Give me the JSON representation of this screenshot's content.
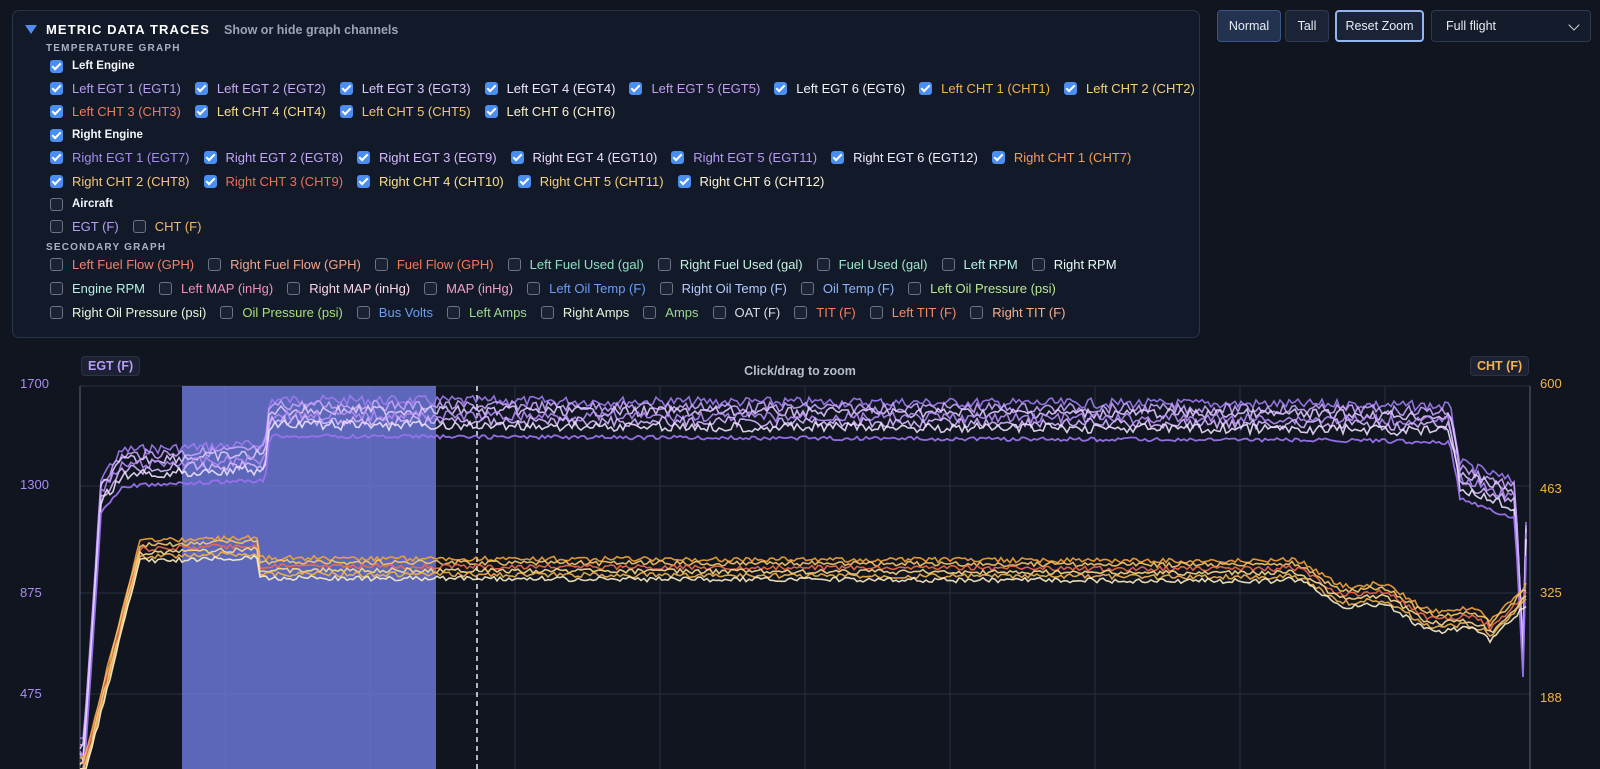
{
  "panel": {
    "title": "METRIC DATA TRACES",
    "subtitle": "Show or hide graph channels",
    "temperature_label": "TEMPERATURE GRAPH",
    "secondary_label": "SECONDARY GRAPH",
    "left_engine": "Left Engine",
    "right_engine": "Right Engine",
    "aircraft": "Aircraft",
    "left_row1": [
      {
        "label": "Left EGT 1 (EGT1)",
        "color": "#b89cf0",
        "checked": true
      },
      {
        "label": "Left EGT 2 (EGT2)",
        "color": "#c8a8f5",
        "checked": true
      },
      {
        "label": "Left EGT 3 (EGT3)",
        "color": "#dcc6ff",
        "checked": true
      },
      {
        "label": "Left EGT 4 (EGT4)",
        "color": "#f0e6ff",
        "checked": true
      },
      {
        "label": "Left EGT 5 (EGT5)",
        "color": "#c49cf2",
        "checked": true
      },
      {
        "label": "Left EGT 6 (EGT6)",
        "color": "#f4f0ff",
        "checked": true
      },
      {
        "label": "Left CHT 1 (CHT1)",
        "color": "#f5b34a",
        "checked": true
      },
      {
        "label": "Left CHT 2 (CHT2)",
        "color": "#f5d27a",
        "checked": true
      }
    ],
    "left_row2": [
      {
        "label": "Left CHT 3 (CHT3)",
        "color": "#f07a5e",
        "checked": true
      },
      {
        "label": "Left CHT 4 (CHT4)",
        "color": "#f7dc88",
        "checked": true
      },
      {
        "label": "Left CHT 5 (CHT5)",
        "color": "#f5c56a",
        "checked": true
      },
      {
        "label": "Left CHT 6 (CHT6)",
        "color": "#fbf1cf",
        "checked": true
      }
    ],
    "right_row1": [
      {
        "label": "Right EGT 1 (EGT7)",
        "color": "#a78bef",
        "checked": true
      },
      {
        "label": "Right EGT 2 (EGT8)",
        "color": "#c4a4f5",
        "checked": true
      },
      {
        "label": "Right EGT 3 (EGT9)",
        "color": "#d6b8ff",
        "checked": true
      },
      {
        "label": "Right EGT 4 (EGT10)",
        "color": "#efdcff",
        "checked": true
      },
      {
        "label": "Right EGT 5 (EGT11)",
        "color": "#b99af2",
        "checked": true
      },
      {
        "label": "Right EGT 6 (EGT12)",
        "color": "#f2ecff",
        "checked": true
      },
      {
        "label": "Right CHT 1 (CHT7)",
        "color": "#f59e4a",
        "checked": true
      }
    ],
    "right_row2": [
      {
        "label": "Right CHT 2 (CHT8)",
        "color": "#f5c677",
        "checked": true
      },
      {
        "label": "Right CHT 3 (CHT9)",
        "color": "#ef6f5a",
        "checked": true
      },
      {
        "label": "Right CHT 4 (CHT10)",
        "color": "#f8e08c",
        "checked": true
      },
      {
        "label": "Right CHT 5 (CHT11)",
        "color": "#f5d07c",
        "checked": true
      },
      {
        "label": "Right CHT 6 (CHT12)",
        "color": "#fcf3d6",
        "checked": true
      }
    ],
    "aircraft_row": [
      {
        "label": "EGT (F)",
        "color": "#b79cf5",
        "checked": false
      },
      {
        "label": "CHT (F)",
        "color": "#f5b86a",
        "checked": false
      }
    ],
    "sec_row1": [
      {
        "label": "Left Fuel Flow (GPH)",
        "color": "#f5826a",
        "checked": false
      },
      {
        "label": "Right Fuel Flow (GPH)",
        "color": "#f5a48a",
        "checked": false
      },
      {
        "label": "Fuel Flow (GPH)",
        "color": "#f57a56",
        "checked": false
      },
      {
        "label": "Left Fuel Used (gal)",
        "color": "#8fe0c0",
        "checked": false
      },
      {
        "label": "Right Fuel Used (gal)",
        "color": "#c6f2e0",
        "checked": false
      },
      {
        "label": "Fuel Used (gal)",
        "color": "#9ee6c8",
        "checked": false
      },
      {
        "label": "Left RPM",
        "color": "#b8f0e6",
        "checked": false
      },
      {
        "label": "Right RPM",
        "color": "#e6fbf6",
        "checked": false
      }
    ],
    "sec_row2": [
      {
        "label": "Engine RPM",
        "color": "#b6f0e2",
        "checked": false
      },
      {
        "label": "Left MAP (inHg)",
        "color": "#f28fb8",
        "checked": false
      },
      {
        "label": "Right MAP (inHg)",
        "color": "#fbd6e6",
        "checked": false
      },
      {
        "label": "MAP (inHg)",
        "color": "#f2a0c6",
        "checked": false
      },
      {
        "label": "Left Oil Temp (F)",
        "color": "#6b9ef5",
        "checked": false
      },
      {
        "label": "Right Oil Temp (F)",
        "color": "#b6cdfb",
        "checked": false
      },
      {
        "label": "Oil Temp (F)",
        "color": "#8fb4f8",
        "checked": false
      },
      {
        "label": "Left Oil Pressure (psi)",
        "color": "#b8e890",
        "checked": false
      }
    ],
    "sec_row3": [
      {
        "label": "Right Oil Pressure (psi)",
        "color": "#e8f8d8",
        "checked": false
      },
      {
        "label": "Oil Pressure (psi)",
        "color": "#a8e070",
        "checked": false
      },
      {
        "label": "Bus Volts",
        "color": "#6b9ef5",
        "checked": false
      },
      {
        "label": "Left Amps",
        "color": "#9ed88c",
        "checked": false
      },
      {
        "label": "Right Amps",
        "color": "#e4f6dc",
        "checked": false
      },
      {
        "label": "Amps",
        "color": "#9cd88a",
        "checked": false
      },
      {
        "label": "OAT (F)",
        "color": "#d8dde6",
        "checked": false
      },
      {
        "label": "TIT (F)",
        "color": "#f5805e",
        "checked": false
      },
      {
        "label": "Left TIT (F)",
        "color": "#f58c68",
        "checked": false
      },
      {
        "label": "Right TIT (F)",
        "color": "#f7b08a",
        "checked": false
      }
    ]
  },
  "controls": {
    "normal": "Normal",
    "tall": "Tall",
    "reset_zoom": "Reset Zoom",
    "range_select": "Full flight"
  },
  "chart": {
    "left_badge": "EGT (F)",
    "right_badge": "CHT (F)",
    "hint": "Click/drag to zoom",
    "left_ticks": [
      "1700",
      "1300",
      "875",
      "475"
    ],
    "right_ticks": [
      "600",
      "463",
      "325",
      "188"
    ],
    "colors": {
      "egt": "#b084f5",
      "cht": "#f5b34a",
      "selection": "#6f7ce0"
    }
  }
}
